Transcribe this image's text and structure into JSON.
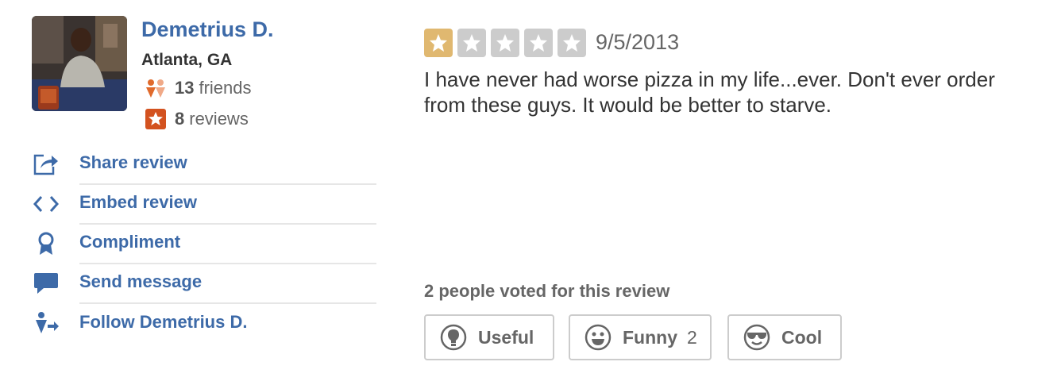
{
  "user": {
    "name": "Demetrius D.",
    "location": "Atlanta, GA",
    "friends_count": "13",
    "friends_label": "friends",
    "reviews_count": "8",
    "reviews_label": "reviews",
    "avatar_icon": "user-photo"
  },
  "actions": [
    {
      "label": "Share review",
      "icon": "share-icon"
    },
    {
      "label": "Embed review",
      "icon": "embed-code-icon"
    },
    {
      "label": "Compliment",
      "icon": "award-ribbon-icon"
    },
    {
      "label": "Send message",
      "icon": "speech-bubble-icon"
    },
    {
      "label": "Follow Demetrius D.",
      "icon": "follow-user-icon"
    }
  ],
  "review": {
    "rating": 1,
    "max_rating": 5,
    "date": "9/5/2013",
    "text": "I have never had worse pizza in my life...ever. Don't ever order from these guys. It would be better to starve."
  },
  "votes": {
    "label": "2 people voted for this review",
    "buttons": [
      {
        "label": "Useful",
        "count": "",
        "icon": "lightbulb-icon"
      },
      {
        "label": "Funny",
        "count": "2",
        "icon": "smiley-icon"
      },
      {
        "label": "Cool",
        "count": "",
        "icon": "sunglasses-smiley-icon"
      }
    ]
  },
  "colors": {
    "link": "#3d6aa8",
    "star_active": "#e0b870",
    "star_inactive": "#cccccc",
    "review_badge": "#d3521f",
    "friends_icon_primary": "#e06a2c",
    "friends_icon_secondary": "#f0a987"
  }
}
